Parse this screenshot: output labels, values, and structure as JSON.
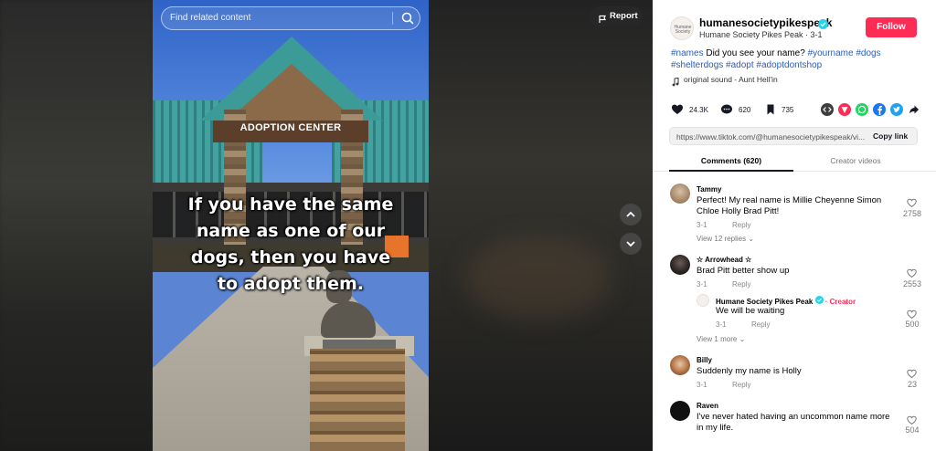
{
  "video": {
    "search_placeholder": "Find related content",
    "report_label": "Report",
    "sign_text": "ADOPTION CENTER",
    "caption": "If you have the same name as one of our dogs, then you have to adopt them."
  },
  "author": {
    "username": "humanesocietypikespeak",
    "nickname_line": "Humane Society Pikes Peak · 3-1",
    "follow_label": "Follow",
    "avatar_text": "Humane Society"
  },
  "description": {
    "parts": [
      {
        "text": "#names",
        "tag": true
      },
      {
        "text": " Did you see your name? ",
        "tag": false
      },
      {
        "text": "#yourname",
        "tag": true
      },
      {
        "text": " ",
        "tag": false
      },
      {
        "text": "#dogs",
        "tag": true
      },
      {
        "text": " ",
        "tag": false
      },
      {
        "text": "#shelterdogs",
        "tag": true
      },
      {
        "text": " ",
        "tag": false
      },
      {
        "text": "#adopt",
        "tag": true
      },
      {
        "text": " ",
        "tag": false
      },
      {
        "text": "#adoptdontshop",
        "tag": true
      }
    ],
    "music": "original sound - Aunt  Hell'in"
  },
  "stats": {
    "likes": "24.3K",
    "comments": "620",
    "saves": "735"
  },
  "share_icons": [
    "embed-icon",
    "friends-icon",
    "whatsapp-icon",
    "facebook-icon",
    "twitter-icon",
    "share-arrow-icon"
  ],
  "link": {
    "url": "https://www.tiktok.com/@humanesocietypikespeak/vi...",
    "copy_label": "Copy link"
  },
  "tabs": {
    "comments": "Comments (620)",
    "creator_videos": "Creator videos"
  },
  "comments": [
    {
      "name": "Tammy",
      "text": "Perfect! My real name is Millie Cheyenne Simon Chloe Holly Brad Pitt!",
      "date": "3-1",
      "reply": "Reply",
      "likes": "2758",
      "view_replies": "View 12 replies"
    },
    {
      "name": "☆ Arrowhead ☆",
      "text": "Brad Pitt better show up",
      "date": "3-1",
      "reply": "Reply",
      "likes": "2553",
      "sub_reply": {
        "name": "Humane Society Pikes Peak",
        "creator_label": "· Creator",
        "text": "We will be waiting",
        "date": "3-1",
        "reply": "Reply",
        "likes": "500"
      },
      "view_replies": "View 1 more"
    },
    {
      "name": "Billy",
      "text": "Suddenly my name is Holly",
      "date": "3-1",
      "reply": "Reply",
      "likes": "23"
    },
    {
      "name": "Raven",
      "text": "I've never hated having an uncommon name more in my life.",
      "likes": "504"
    }
  ],
  "colors": {
    "accent": "#fe2c55",
    "hashtag": "#2b5db9",
    "verified": "#20d5ec"
  }
}
